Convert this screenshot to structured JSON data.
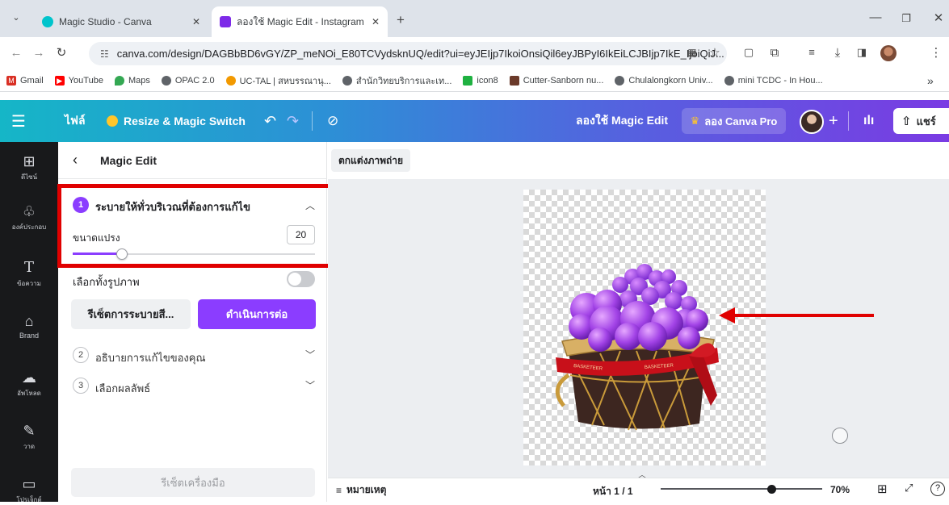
{
  "browser": {
    "tabs": [
      {
        "title": "Magic Studio - Canva",
        "icon": "canva-favicon",
        "active": false
      },
      {
        "title": "ลองใช้ Magic Edit - Instagram โพ",
        "icon": "canva-favicon",
        "active": true
      }
    ],
    "new_tab_glyph": "+",
    "url": "canva.com/design/DAGBbBD6vGY/ZP_meNOi_E80TCVydsknUQ/edit?ui=eyJEIjp7IkoiOnsiQil6eyJBPyI6IkEiLCJBIjp7IkE_IjoiQiJ...",
    "bookmarks": [
      {
        "label": "Gmail",
        "icon": "gmail-icon",
        "color": "#d93025"
      },
      {
        "label": "YouTube",
        "icon": "youtube-icon",
        "color": "#ff0000"
      },
      {
        "label": "Maps",
        "icon": "maps-icon",
        "color": "#34a853"
      },
      {
        "label": "OPAC 2.0",
        "icon": "globe-icon",
        "color": "#5f6368"
      },
      {
        "label": "UC-TAL | สหบรรณานุ...",
        "icon": "uc-icon",
        "color": "#f29900"
      },
      {
        "label": "สำนักวิทยบริการและเท...",
        "icon": "globe-icon",
        "color": "#5f6368"
      },
      {
        "label": "icon8",
        "icon": "icons8-icon",
        "color": "#1fb141"
      },
      {
        "label": "Cutter-Sanborn nu...",
        "icon": "cutter-icon",
        "color": "#6b3a2a"
      },
      {
        "label": "Chulalongkorn Univ...",
        "icon": "globe-icon",
        "color": "#5f6368"
      },
      {
        "label": "mini TCDC - In Hou...",
        "icon": "globe-icon",
        "color": "#5f6368"
      }
    ],
    "more_glyph": "»"
  },
  "header": {
    "file_label": "ไฟล์",
    "resize_label": "Resize & Magic Switch",
    "title": "ลองใช้ Magic Edit",
    "pro_label": "ลอง Canva Pro",
    "share_label": "แชร์"
  },
  "rail": [
    {
      "label": "ดีไซน์",
      "icon": "layout-icon",
      "glyph": "⊞"
    },
    {
      "label": "องค์ประกอบ",
      "icon": "elements-icon",
      "glyph": "♧"
    },
    {
      "label": "ข้อความ",
      "icon": "text-icon",
      "glyph": "T"
    },
    {
      "label": "Brand",
      "icon": "brand-icon",
      "glyph": "⌂"
    },
    {
      "label": "อัพโหลด",
      "icon": "upload-icon",
      "glyph": "☁"
    },
    {
      "label": "วาด",
      "icon": "draw-icon",
      "glyph": "✎"
    },
    {
      "label": "โปรเจ็กต์",
      "icon": "folder-icon",
      "glyph": "▭"
    }
  ],
  "panel": {
    "title": "Magic Edit",
    "step1": {
      "num": "1",
      "title": "ระบายให้ทั่วบริเวณที่ต้องการแก้ไข"
    },
    "brush_label": "ขนาดแปรง",
    "brush_value": "20",
    "brush_fraction": 0.19,
    "select_all_label": "เลือกทั้งรูปภาพ",
    "select_all_on": false,
    "reset_brush_label": "รีเซ็ตการระบายสี...",
    "continue_label": "ดำเนินการต่อ",
    "step2": {
      "num": "2",
      "title": "อธิบายการแก้ไขของคุณ"
    },
    "step3": {
      "num": "3",
      "title": "เลือกผลลัพธ์"
    },
    "reset_tool_label": "รีเซ็ตเครื่องมือ"
  },
  "canvas": {
    "crumb_label": "ตกแต่งภาพถ่าย",
    "ribbon_text": "BASKETEER"
  },
  "footer": {
    "notes_label": "หมายเหตุ",
    "page_label": "หน้า 1 / 1",
    "zoom_fraction": 0.7,
    "zoom_label": "70%"
  },
  "colors": {
    "annotation_red": "#e00000",
    "canva_purple": "#8b3dff"
  }
}
